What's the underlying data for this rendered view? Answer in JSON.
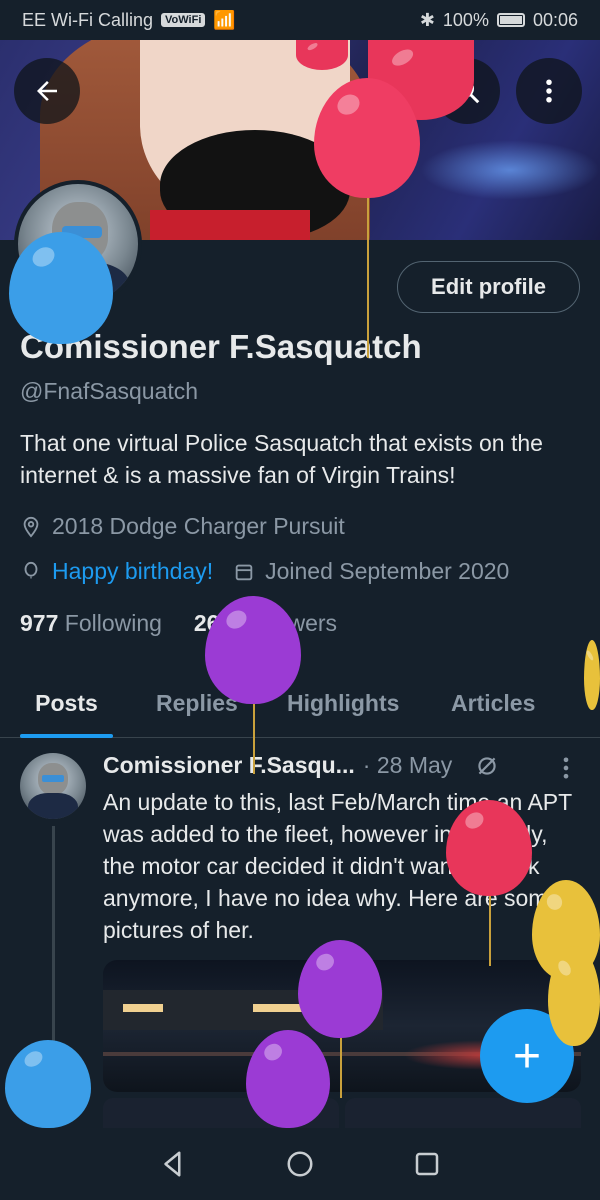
{
  "status_bar": {
    "carrier": "EE Wi-Fi Calling",
    "volte": "VoWiFi",
    "battery": "100%",
    "time": "00:06"
  },
  "header": {
    "back_icon": "arrow-left-icon",
    "search_icon": "search-icon",
    "more_icon": "more-vertical-icon"
  },
  "profile": {
    "edit_button": "Edit profile",
    "name": "Comissioner F.Sasquatch",
    "handle": "@FnafSasquatch",
    "bio": "That one virtual Police Sasquatch that exists on the internet & is a massive fan of Virgin Trains!",
    "location": "2018 Dodge Charger Pursuit",
    "birthday": "Happy birthday!",
    "joined": "Joined September 2020",
    "following_count": "977",
    "following_label": "Following",
    "followers_count": "267",
    "followers_label": "Followers"
  },
  "tabs": [
    {
      "label": "Posts",
      "active": true
    },
    {
      "label": "Replies",
      "active": false
    },
    {
      "label": "Highlights",
      "active": false
    },
    {
      "label": "Articles",
      "active": false
    }
  ],
  "post": {
    "author": "Comissioner F.Sasqu...",
    "date": "· 28 May",
    "text": "An update to this, last Feb/March time an APT was added to the fleet, however in mid July, the motor car decided it didn't want to work anymore, I have no idea why. Here are some pictures of her."
  },
  "fab": {
    "label": "+"
  },
  "colors": {
    "background": "#15202b",
    "accent": "#1d9bf0",
    "muted": "#8b98a5",
    "text": "#e7e9ea",
    "border": "#38444d"
  },
  "nav": [
    "back-triangle-icon",
    "home-circle-icon",
    "recents-square-icon"
  ]
}
